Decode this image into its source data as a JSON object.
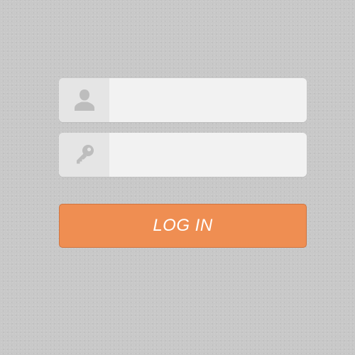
{
  "form": {
    "username": {
      "icon": "user-icon",
      "value": "",
      "placeholder": ""
    },
    "password": {
      "icon": "key-icon",
      "value": "",
      "placeholder": ""
    },
    "login_button": {
      "label": "LOG IN"
    }
  },
  "colors": {
    "background": "#c8c8c8",
    "field_background": "#f2f2f2",
    "icon_box_background": "#e5e5e5",
    "icon": "#bdbdbd",
    "button": "#ef8e52",
    "button_border": "#cf7440",
    "button_text": "#ffffff"
  }
}
